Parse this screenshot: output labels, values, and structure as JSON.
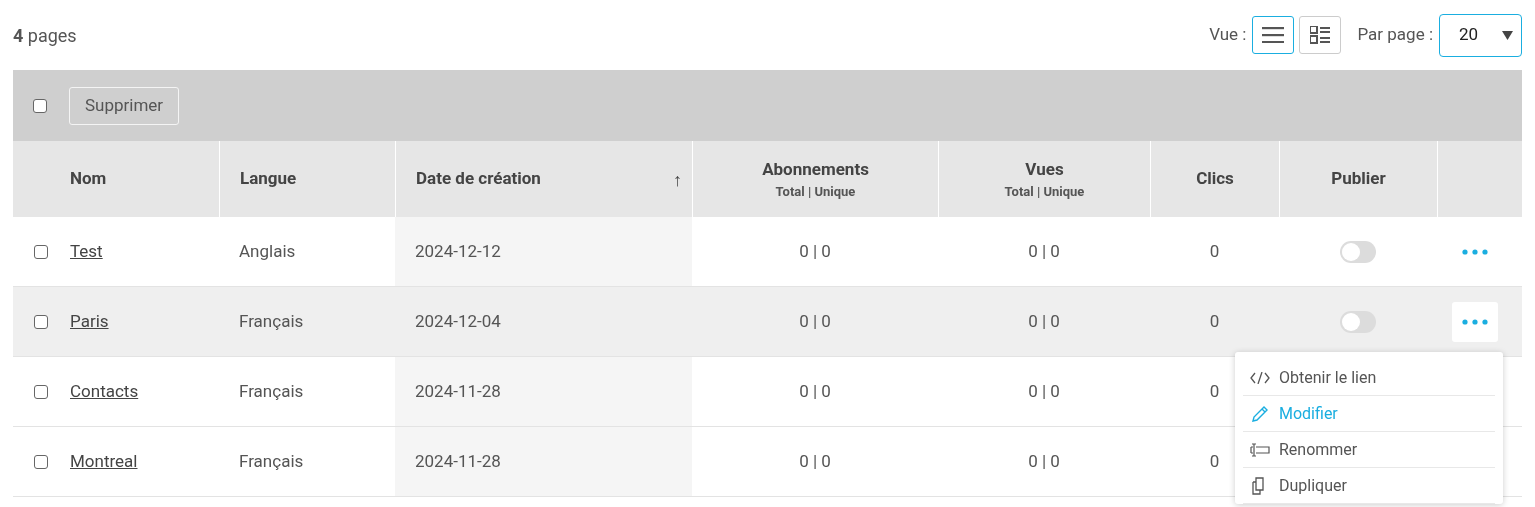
{
  "summary": "**4** pages",
  "view": {
    "label": "Vue :",
    "options": [
      {
        "kind": "list",
        "selected": true
      },
      {
        "kind": "grid",
        "selected": false
      }
    ]
  },
  "per_page": {
    "label": "Par page :",
    "value": "20"
  },
  "bulk": {
    "checked": false,
    "delete_label": "Supprimer"
  },
  "table": {
    "columns": [
      {
        "label": "Nom"
      },
      {
        "label": "Langue"
      },
      {
        "label": "Date de création",
        "sorted": true,
        "sort_icon": "↑"
      },
      {
        "label": "Abonnements",
        "sub": "Total | Unique"
      },
      {
        "label": "Vues",
        "sub": "Total | Unique"
      },
      {
        "label": "Clics"
      },
      {
        "label": "Publier"
      }
    ],
    "rows": [
      {
        "checked": false,
        "name": "Test",
        "language": "Anglais",
        "created": "2024-12-12",
        "subscriptions": "0 | 0",
        "views": "0 | 0",
        "clicks": "0",
        "published": false,
        "hovered": false
      },
      {
        "checked": false,
        "name": "Paris",
        "language": "Français",
        "created": "2024-12-04",
        "subscriptions": "0 | 0",
        "views": "0 | 0",
        "clicks": "0",
        "published": false,
        "hovered": true,
        "menu_open": true
      },
      {
        "checked": false,
        "name": "Contacts",
        "language": "Français",
        "created": "2024-11-28",
        "subscriptions": "0 | 0",
        "views": "0 | 0",
        "clicks": "0"
      },
      {
        "checked": false,
        "name": "Montreal",
        "language": "Français",
        "created": "2024-11-28",
        "subscriptions": "0 | 0",
        "views": "0 | 0",
        "clicks": "0"
      }
    ]
  },
  "action_menu": {
    "items": [
      {
        "kind": "code",
        "label": "Obtenir le lien",
        "highlighted": false
      },
      {
        "kind": "edit",
        "label": "Modifier",
        "highlighted": true
      },
      {
        "kind": "rename",
        "label": "Renommer",
        "highlighted": false
      },
      {
        "kind": "duplicate",
        "label": "Dupliquer",
        "highlighted": false
      }
    ]
  }
}
